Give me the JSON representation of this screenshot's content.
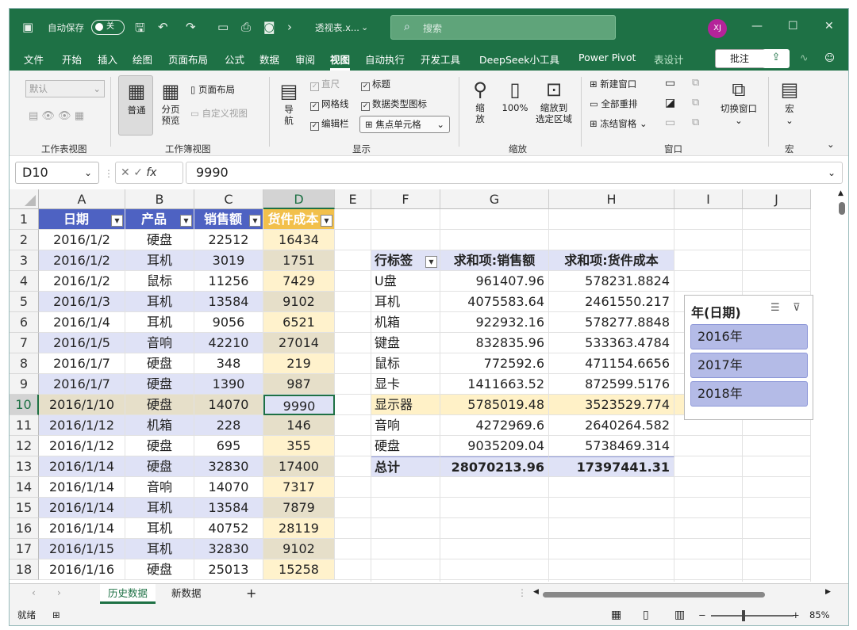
{
  "titlebar": {
    "autosave_label": "自动保存",
    "autosave_state": "关",
    "filename": "透视表.x...",
    "search_placeholder": "搜索",
    "avatar_initials": "XJ",
    "accent": "#1e7145"
  },
  "menu": {
    "items": [
      "文件",
      "开始",
      "插入",
      "绘图",
      "页面布局",
      "公式",
      "数据",
      "审阅",
      "视图",
      "自动执行",
      "开发工具",
      "DeepSeek小工具",
      "Power Pivot",
      "表设计"
    ],
    "active": "视图",
    "comment": "批注"
  },
  "ribbon": {
    "view_dropdown": "默认",
    "normal": "普通",
    "page_break": "分页\n预览",
    "page_layout": "页面布局",
    "custom_view": "自定义视图",
    "ruler": "直尺",
    "gridlines": "网格线",
    "formula_bar": "编辑栏",
    "headings": "标题",
    "data_type_icons": "数据类型图标",
    "focus_cell": "焦点单元格",
    "navigate": "导\n航",
    "zoom": "缩\n放",
    "zoom100": "100%",
    "zoom_selection": "缩放到\n选定区域",
    "new_window": "新建窗口",
    "arrange_all": "全部重排",
    "freeze_panes": "冻结窗格",
    "switch_windows": "切换窗口",
    "macros": "宏",
    "groups": {
      "sheet_view": "工作表视图",
      "workbook_view": "工作簿视图",
      "show": "显示",
      "zoom": "缩放",
      "window": "窗口",
      "macro": "宏"
    }
  },
  "formula_bar": {
    "name_box": "D10",
    "fx": "fx",
    "value": "9990"
  },
  "columns": [
    "A",
    "B",
    "C",
    "D",
    "E",
    "F",
    "G",
    "H",
    "I",
    "J"
  ],
  "rows": [
    "1",
    "2",
    "3",
    "4",
    "5",
    "6",
    "7",
    "8",
    "9",
    "10",
    "11",
    "12",
    "13",
    "14",
    "15",
    "16",
    "17",
    "18"
  ],
  "table": {
    "headers": [
      "日期",
      "产品",
      "销售额",
      "货件成本"
    ],
    "rows": [
      [
        "2016/1/2",
        "硬盘",
        "22512",
        "16434"
      ],
      [
        "2016/1/2",
        "耳机",
        "3019",
        "1751"
      ],
      [
        "2016/1/2",
        "鼠标",
        "11256",
        "7429"
      ],
      [
        "2016/1/3",
        "耳机",
        "13584",
        "9102"
      ],
      [
        "2016/1/4",
        "耳机",
        "9056",
        "6521"
      ],
      [
        "2016/1/5",
        "音响",
        "42210",
        "27014"
      ],
      [
        "2016/1/7",
        "硬盘",
        "348",
        "219"
      ],
      [
        "2016/1/7",
        "硬盘",
        "1390",
        "987"
      ],
      [
        "2016/1/10",
        "硬盘",
        "14070",
        "9990"
      ],
      [
        "2016/1/12",
        "机箱",
        "228",
        "146"
      ],
      [
        "2016/1/12",
        "硬盘",
        "695",
        "355"
      ],
      [
        "2016/1/14",
        "硬盘",
        "32830",
        "17400"
      ],
      [
        "2016/1/14",
        "音响",
        "14070",
        "7317"
      ],
      [
        "2016/1/14",
        "耳机",
        "13584",
        "7879"
      ],
      [
        "2016/1/14",
        "耳机",
        "40752",
        "28119"
      ],
      [
        "2016/1/15",
        "耳机",
        "32830",
        "9102"
      ],
      [
        "2016/1/16",
        "硬盘",
        "25013",
        "15258"
      ]
    ]
  },
  "pivot": {
    "headers": [
      "行标签",
      "求和项:销售额",
      "求和项:货件成本"
    ],
    "rows": [
      [
        "U盘",
        "961407.96",
        "578231.8824"
      ],
      [
        "耳机",
        "4075583.64",
        "2461550.217"
      ],
      [
        "机箱",
        "922932.16",
        "578277.8848"
      ],
      [
        "键盘",
        "832835.96",
        "533363.4784"
      ],
      [
        "鼠标",
        "772592.6",
        "471154.6656"
      ],
      [
        "显卡",
        "1411663.52",
        "872599.5176"
      ],
      [
        "显示器",
        "5785019.48",
        "3523529.774"
      ],
      [
        "音响",
        "4272969.6",
        "2640264.582"
      ],
      [
        "硬盘",
        "9035209.04",
        "5738469.314"
      ]
    ],
    "total": [
      "总计",
      "28070213.96",
      "17397441.31"
    ]
  },
  "slicer": {
    "title": "年(日期)",
    "items": [
      "2016年",
      "2017年",
      "2018年"
    ]
  },
  "sheets": {
    "tabs": [
      "历史数据",
      "新数据"
    ],
    "active": "历史数据"
  },
  "status": {
    "ready": "就绪",
    "zoom": "85%"
  }
}
